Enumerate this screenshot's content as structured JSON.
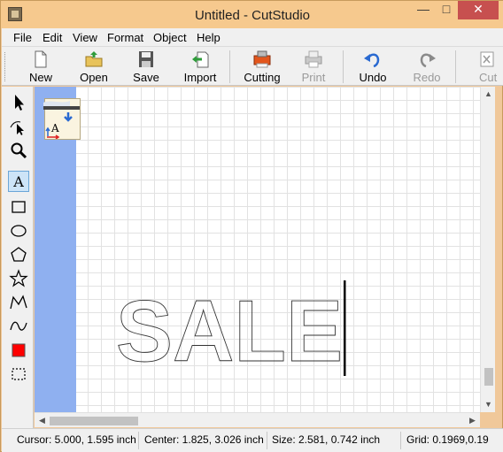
{
  "window": {
    "title": "Untitled - CutStudio",
    "controls": {
      "minimize": "—",
      "maximize": "□",
      "close": "✕"
    }
  },
  "menu": {
    "items": [
      "File",
      "Edit",
      "View",
      "Format",
      "Object",
      "Help"
    ]
  },
  "toolbar": {
    "buttons": [
      {
        "label": "New",
        "icon": "new-document-icon"
      },
      {
        "label": "Open",
        "icon": "open-folder-icon"
      },
      {
        "label": "Save",
        "icon": "floppy-disk-icon"
      },
      {
        "label": "Import",
        "icon": "import-icon"
      },
      {
        "label": "Cutting",
        "icon": "cutter-icon"
      },
      {
        "label": "Print",
        "icon": "printer-icon",
        "disabled": true
      },
      {
        "label": "Undo",
        "icon": "undo-icon"
      },
      {
        "label": "Redo",
        "icon": "redo-icon",
        "disabled": true
      },
      {
        "label": "Cut",
        "icon": "cut-icon",
        "disabled": true
      }
    ]
  },
  "tools": [
    "select-arrow-icon",
    "node-edit-icon",
    "zoom-icon",
    "text-tool-icon",
    "rectangle-icon",
    "ellipse-icon",
    "polygon-icon",
    "star-icon",
    "polyline-icon",
    "curve-icon",
    "fill-color-icon",
    "marquee-icon"
  ],
  "canvas": {
    "text": "SALE",
    "text_tool_glyph": "A",
    "colors": {
      "margin": "#8fb0f0",
      "grid": "#e2e2e2",
      "fill_swatch": "#ff0000"
    }
  },
  "status": {
    "cursor": "Cursor: 5.000, 1.595 inch",
    "center": "Center: 1.825, 3.026 inch",
    "size": "Size: 2.581, 0.742 inch",
    "grid": "Grid: 0.1969,0.19"
  }
}
